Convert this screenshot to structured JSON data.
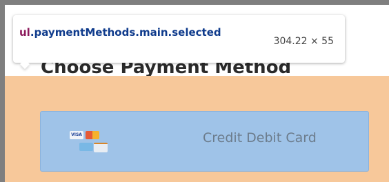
{
  "page": {
    "heading": "Choose Payment Method",
    "payment_method": {
      "label": "Credit Debit Card",
      "card_icons": [
        "visa-icon",
        "mastercard-icon",
        "amex-icon",
        "discover-icon"
      ],
      "visa_text": "VISA"
    }
  },
  "devtools_tooltip": {
    "tag": "ul",
    "selector_rest": ".paymentMethods.main.selected",
    "dimensions": "304.22 × 55"
  },
  "colors": {
    "orange_band": "#f7c89a",
    "highlight": "#9fc3e8",
    "tag_color": "#8c1a5c",
    "selector_color": "#0f3b8c"
  }
}
